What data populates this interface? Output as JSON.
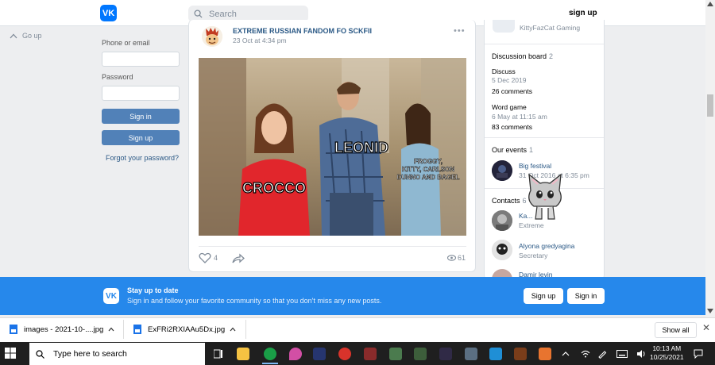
{
  "topbar": {
    "search_placeholder": "Search",
    "signup": "sign up"
  },
  "goup": "Go up",
  "login": {
    "phone_label": "Phone or email",
    "password_label": "Password",
    "sign_in": "Sign in",
    "sign_up": "Sign up",
    "forgot": "Forgot your password?"
  },
  "post": {
    "author": "EXTREME RUSSIAN FANDOM FO SCKFII",
    "date": "23 Oct at 4:34 pm",
    "menu": "•••",
    "meme_labels": {
      "left": "CROCCO",
      "middle": "LEONID",
      "right": "FROGGY, KITTY, CARLSON DUNNO AND BAGEL"
    },
    "likes": "4",
    "views": "61"
  },
  "right": {
    "top_member": "KittyFazCat Gaming",
    "discussion": {
      "title": "Discussion board",
      "count": "2",
      "topics": [
        {
          "name": "Discuss",
          "date": "5 Dec 2019",
          "comments": "26 comments"
        },
        {
          "name": "Word game",
          "date": "6 May at 11:15 am",
          "comments": "83 comments"
        }
      ]
    },
    "events": {
      "title": "Our events",
      "count": "1",
      "item_name": "Big festival",
      "item_date": "31 Oct 2016 at 6:35 pm"
    },
    "contacts": {
      "title": "Contacts",
      "count": "6",
      "items": [
        {
          "name": "Ka...",
          "role": "Extreme"
        },
        {
          "name": "Alyona gredyagina",
          "role": "Secretary"
        },
        {
          "name": "Damir levin",
          "role": ""
        }
      ]
    }
  },
  "banner": {
    "title": "Stay up to date",
    "text": "Sign in and follow your favorite community so that you don't miss any new posts.",
    "signup": "Sign up",
    "signin": "Sign in"
  },
  "downloads": {
    "items": [
      "images - 2021-10-....jpg",
      "ExFRi2RXIAAu5Dx.jpg"
    ],
    "show_all": "Show all"
  },
  "taskbar": {
    "search_placeholder": "Type here to search",
    "time": "10:13 AM",
    "date": "10/25/2021"
  },
  "colors": {
    "vk_blue": "#0077ff",
    "banner_blue": "#2688eb",
    "button_blue": "#5181b8",
    "link": "#2a5885"
  }
}
